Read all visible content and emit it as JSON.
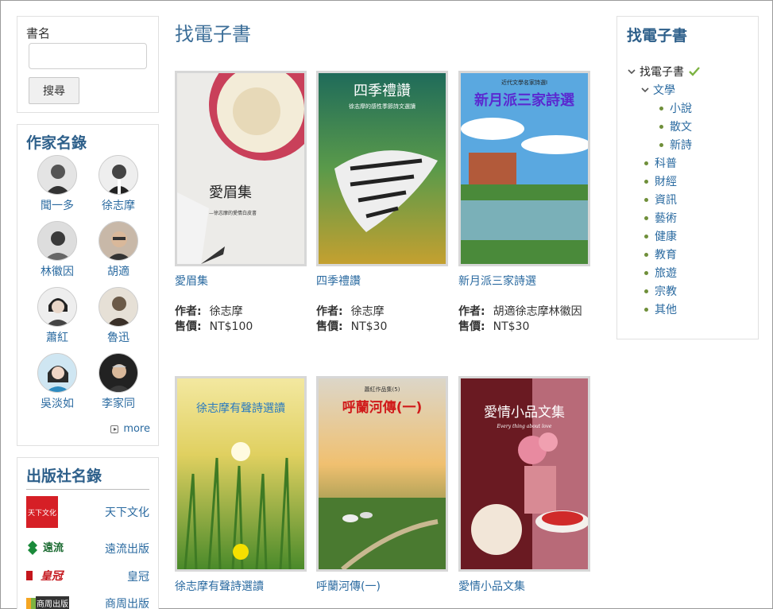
{
  "search": {
    "label": "書名",
    "input_value": "",
    "placeholder": "",
    "button_label": "搜尋"
  },
  "authors": {
    "title": "作家名錄",
    "items": [
      {
        "name": "聞一多",
        "icon": "author-portrait"
      },
      {
        "name": "徐志摩",
        "icon": "author-portrait"
      },
      {
        "name": "林徽因",
        "icon": "author-portrait"
      },
      {
        "name": "胡適",
        "icon": "author-portrait"
      },
      {
        "name": "蕭紅",
        "icon": "author-portrait"
      },
      {
        "name": "魯迅",
        "icon": "author-portrait"
      },
      {
        "name": "吳淡如",
        "icon": "author-portrait"
      },
      {
        "name": "李家同",
        "icon": "author-portrait"
      }
    ],
    "more_label": "more"
  },
  "publishers": {
    "title": "出版社名錄",
    "items": [
      {
        "name": "天下文化",
        "logo_text": "天下文化"
      },
      {
        "name": "遠流出版",
        "logo_text": "遠流"
      },
      {
        "name": "皇冠",
        "logo_text": "皇冠"
      },
      {
        "name": "商周出版",
        "logo_text": "商周出版"
      }
    ]
  },
  "main": {
    "title": "找電子書",
    "author_key": "作者:",
    "price_key": "售價:",
    "books": [
      {
        "title": "愛眉集",
        "author": "徐志摩",
        "price": "NT$100",
        "cover_text": "愛眉集",
        "cover_subtext": "—徐志摩的愛情白皮書"
      },
      {
        "title": "四季禮讚",
        "author": "徐志摩",
        "price": "NT$30",
        "cover_text": "四季禮讚",
        "cover_subtext": "徐志摩的感性季節詩文選讀"
      },
      {
        "title": "新月派三家詩選",
        "author": "胡適徐志摩林徽因",
        "price": "NT$30",
        "cover_text": "新月派三家詩選",
        "cover_subtext": "近代文學名家詩選I"
      },
      {
        "title": "徐志摩有聲詩選讀",
        "author": "",
        "price": "",
        "cover_text": "徐志摩有聲詩選讀",
        "cover_subtext": ""
      },
      {
        "title": "呼蘭河傳(一)",
        "author": "",
        "price": "",
        "cover_text": "呼蘭河傳(一)",
        "cover_subtext": "蕭紅作品集(5)"
      },
      {
        "title": "愛情小品文集",
        "author": "",
        "price": "",
        "cover_text": "愛情小品文集",
        "cover_subtext": "Every thing about love"
      }
    ]
  },
  "categories": {
    "title": "找電子書",
    "root": "找電子書",
    "level1_open": "文學",
    "level2": [
      "小說",
      "散文",
      "新詩"
    ],
    "others": [
      "科普",
      "財經",
      "資訊",
      "藝術",
      "健康",
      "教育",
      "旅遊",
      "宗教",
      "其他"
    ]
  },
  "colors": {
    "link": "#2a6aa0",
    "heading": "#2d5f8a",
    "check": "#7cb342"
  }
}
